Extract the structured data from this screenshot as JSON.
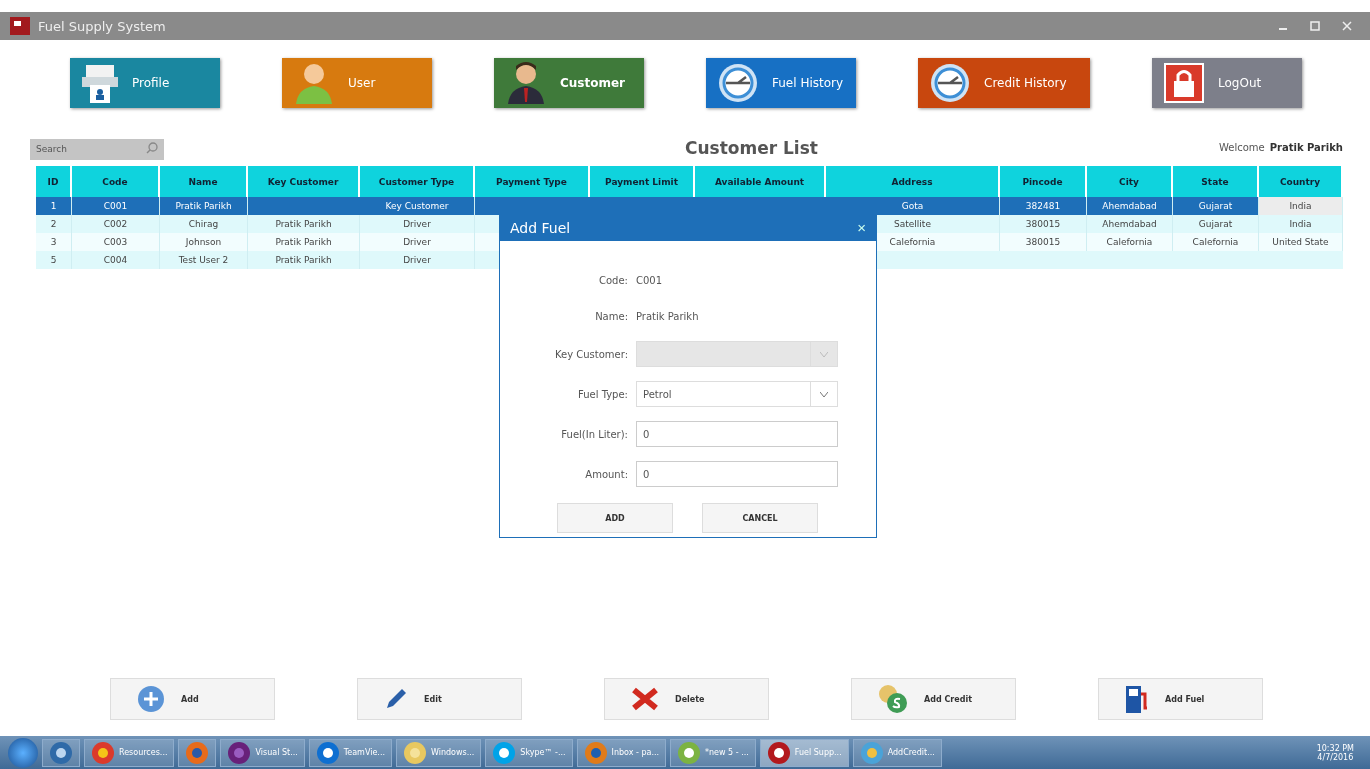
{
  "window": {
    "title": "Fuel Supply System"
  },
  "nav": [
    {
      "label": "Profile",
      "color": "#1a87a0",
      "kind": "printer"
    },
    {
      "label": "User",
      "color": "#d77a0f",
      "kind": "user"
    },
    {
      "label": "Customer",
      "color": "#3f7a3a",
      "kind": "customer",
      "selected": true
    },
    {
      "label": "Fuel History",
      "color": "#1770c4",
      "kind": "history"
    },
    {
      "label": "Credit History",
      "color": "#c8470e",
      "kind": "history"
    },
    {
      "label": "LogOut",
      "color": "#7d7f8a",
      "kind": "logout"
    }
  ],
  "search": {
    "placeholder": "Search"
  },
  "heading": "Customer List",
  "welcome": {
    "label": "Welcome",
    "user": "Pratik Parikh"
  },
  "table": {
    "columns": [
      "ID",
      "Code",
      "Name",
      "Key Customer",
      "Customer Type",
      "Payment Type",
      "Payment Limit",
      "Available Amount",
      "Address",
      "Pincode",
      "City",
      "State",
      "Country"
    ],
    "rows": [
      {
        "selected": true,
        "cells": [
          "1",
          "C001",
          "Pratik Parikh",
          "",
          "Key Customer",
          "",
          "",
          "",
          "Gota",
          "382481",
          "Ahemdabad",
          "Gujarat",
          "India"
        ]
      },
      {
        "selected": false,
        "cells": [
          "2",
          "C002",
          "Chirag",
          "Pratik Parikh",
          "Driver",
          "",
          "",
          "",
          "Satellite",
          "380015",
          "Ahemdabad",
          "Gujarat",
          "India"
        ]
      },
      {
        "selected": false,
        "cells": [
          "3",
          "C003",
          "Johnson",
          "Pratik Parikh",
          "Driver",
          "",
          "",
          "",
          "Calefornia",
          "380015",
          "Calefornia",
          "Calefornia",
          "United State"
        ]
      },
      {
        "selected": false,
        "cells": [
          "5",
          "C004",
          "Test User 2",
          "Pratik Parikh",
          "Driver",
          "",
          "",
          "",
          "",
          "",
          "",
          "",
          ""
        ]
      }
    ]
  },
  "dialog": {
    "title": "Add Fuel",
    "close": "×",
    "fields": [
      {
        "label": "Code:",
        "kind": "text",
        "value": "C001"
      },
      {
        "label": "Name:",
        "kind": "text",
        "value": "Pratik Parikh"
      },
      {
        "label": "Key Customer:",
        "kind": "select",
        "disabled": true
      },
      {
        "label": "Fuel Type:",
        "kind": "select",
        "value": "Petrol",
        "disabled": false
      },
      {
        "label": "Fuel(In Liter):",
        "kind": "input",
        "value": "0"
      },
      {
        "label": "Amount:",
        "kind": "input",
        "value": "0"
      }
    ],
    "buttons": [
      "ADD",
      "CANCEL"
    ]
  },
  "actions": [
    {
      "label": "Add",
      "kind": "add"
    },
    {
      "label": "Edit",
      "kind": "edit"
    },
    {
      "label": "Delete",
      "kind": "delete"
    },
    {
      "label": "Add Credit",
      "kind": "credit"
    },
    {
      "label": "Add Fuel",
      "kind": "fuel"
    }
  ],
  "taskbar": {
    "items": [
      {
        "kind": "media"
      },
      {
        "label": "Resources...",
        "kind": "chrome"
      },
      {
        "kind": "firefox"
      },
      {
        "label": "Visual St...",
        "kind": "vs"
      },
      {
        "label": "TeamVie...",
        "kind": "teamviewer"
      },
      {
        "label": "Windows...",
        "kind": "folder"
      },
      {
        "label": "Skype™ -...",
        "kind": "skype"
      },
      {
        "label": "Inbox - pa...",
        "kind": "outlook"
      },
      {
        "label": "*new 5 - ...",
        "kind": "notepad"
      },
      {
        "label": "Fuel Supp...",
        "kind": "fuel",
        "selected": true
      },
      {
        "label": "AddCredit...",
        "kind": "paint"
      }
    ],
    "time": "10:32 PM",
    "date": "4/7/2016"
  }
}
